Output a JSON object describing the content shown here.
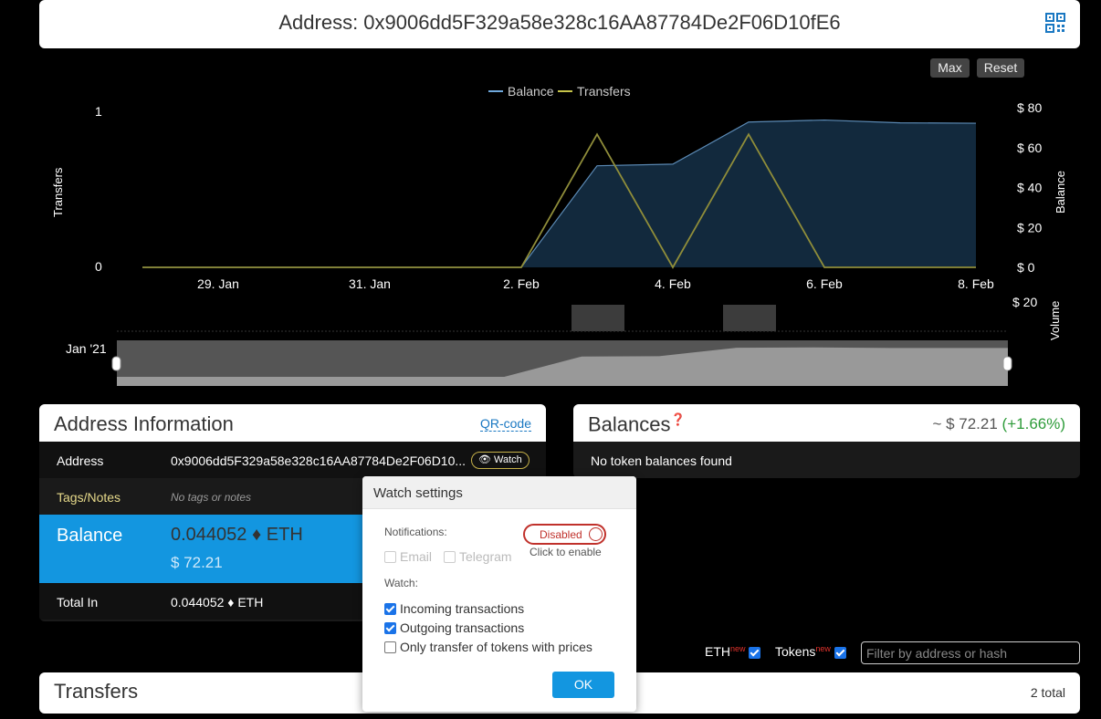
{
  "header": {
    "title": "Address: 0x9006dd5F329a58e328c16AA87784De2F06D10fE6",
    "qr_icon": "qr-code-icon"
  },
  "chart_controls": {
    "max_label": "Max",
    "reset_label": "Reset"
  },
  "chart_data": {
    "type": "area",
    "legend": [
      "Balance",
      "Transfers"
    ],
    "legend_position": "top-center",
    "x": [
      "28. Jan",
      "29. Jan",
      "30. Jan",
      "31. Jan",
      "1. Feb",
      "2. Feb",
      "3. Feb",
      "4. Feb",
      "5. Feb",
      "6. Feb",
      "7. Feb",
      "8. Feb"
    ],
    "xticks": [
      "29. Jan",
      "31. Jan",
      "2. Feb",
      "4. Feb",
      "6. Feb",
      "8. Feb"
    ],
    "series": [
      {
        "name": "Balance",
        "axis": "right",
        "color": "#6fa8dc",
        "values": [
          0,
          0,
          0,
          0,
          0,
          0,
          50.9,
          51.7,
          72.8,
          73.8,
          72.4,
          72.2
        ]
      },
      {
        "name": "Transfers",
        "axis": "left",
        "color": "#c6c44a",
        "values": [
          0,
          0,
          0,
          0,
          0,
          0,
          1,
          0,
          1,
          0,
          0,
          0
        ]
      }
    ],
    "ylabel_left": "Transfers",
    "yticks_left": [
      "0",
      "1"
    ],
    "ylim_left": [
      0,
      1.2
    ],
    "ylabel_right": "Balance",
    "yticks_right": [
      "$ 0",
      "$ 20",
      "$ 40",
      "$ 60",
      "$ 80"
    ],
    "ylim_right": [
      0,
      80
    ],
    "volume_label": "Volume",
    "volume_tick": "$ 20",
    "navigator_label": "Jan '21"
  },
  "address_info": {
    "title": "Address Information",
    "qr_link": "QR-code",
    "address_key": "Address",
    "address_value": "0x9006dd5F329a58e328c16AA87784De2F06D10...",
    "watch_label": "Watch",
    "tags_key": "Tags/Notes",
    "tags_value": "No tags or notes",
    "balance_key": "Balance",
    "balance_eth": "0.044052",
    "balance_unit": "ETH",
    "balance_usd": "$ 72.21",
    "total_in_key": "Total In",
    "total_in_value": "0.044052",
    "total_in_unit": "ETH"
  },
  "balances": {
    "title": "Balances",
    "total": "~ $ 72.21",
    "change": "(+1.66%)",
    "empty_text": "No token balances found"
  },
  "filters": {
    "eth_label": "ETH",
    "tokens_label": "Tokens",
    "new_badge": "new",
    "eth_checked": true,
    "tokens_checked": true,
    "search_placeholder": "Filter by address or hash"
  },
  "transfers": {
    "title": "Transfers",
    "total": "2 total"
  },
  "watch_popup": {
    "title": "Watch settings",
    "notifications_label": "Notifications:",
    "toggle_label": "Disabled",
    "toggle_hint": "Click to enable",
    "email_label": "Email",
    "telegram_label": "Telegram",
    "watch_label": "Watch:",
    "options": [
      {
        "label": "Incoming transactions",
        "checked": true
      },
      {
        "label": "Outgoing transactions",
        "checked": true
      },
      {
        "label": "Only transfer of tokens with prices",
        "checked": false
      }
    ],
    "ok_label": "OK"
  }
}
